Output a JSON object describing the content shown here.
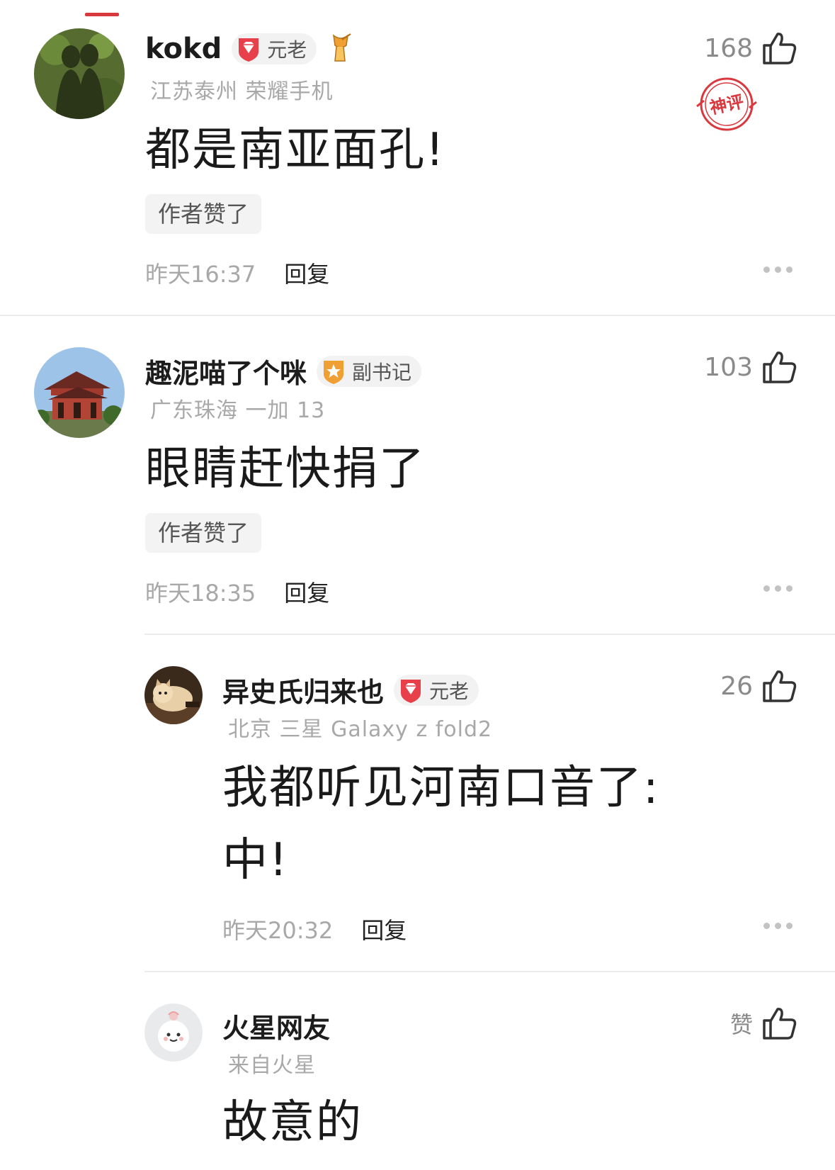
{
  "comments": [
    {
      "username": "kokd",
      "badge": "元老",
      "location_device": "江苏泰州 荣耀手机",
      "text": "都是南亚面孔!",
      "author_liked": "作者赞了",
      "time": "昨天16:37",
      "reply": "回复",
      "likes": "168",
      "stamp": "神评"
    },
    {
      "username": "趣泥喵了个咪",
      "badge": "副书记",
      "location_device": "广东珠海 一加 13",
      "text": "眼睛赶快捐了",
      "author_liked": "作者赞了",
      "time": "昨天18:35",
      "reply": "回复",
      "likes": "103"
    },
    {
      "username": "异史氏归来也",
      "badge": "元老",
      "location_device": "北京 三星 Galaxy z fold2",
      "text_line1": "我都听见河南口音了:",
      "text_line2": "中!",
      "time": "昨天20:32",
      "reply": "回复",
      "likes": "26"
    },
    {
      "username": "火星网友",
      "location_device": "来自火星",
      "text": "故意的",
      "likes": "赞"
    }
  ],
  "colors": {
    "accent": "#d9383e",
    "badge_red": "#e8404a",
    "badge_orange": "#f0a032",
    "like_icon": "#333333"
  },
  "icons": [
    "thumbs-up-icon",
    "more-dots-icon",
    "diamond-badge-icon",
    "star-badge-icon",
    "trophy-hand-icon",
    "god-comment-stamp"
  ]
}
